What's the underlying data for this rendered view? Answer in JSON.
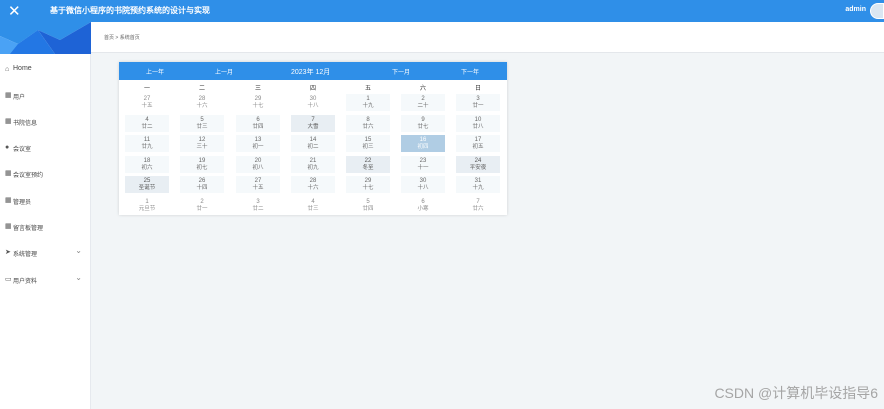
{
  "header": {
    "close_icon": "close-icon",
    "title": "基于微信小程序的书院预约系统的设计与实现",
    "user": "admin"
  },
  "sidebar": {
    "items": [
      {
        "label": "Home",
        "icon": "home-icon",
        "caret": false
      },
      {
        "label": "用户",
        "icon": "grid-icon",
        "caret": false
      },
      {
        "label": "书院信息",
        "icon": "grid-icon",
        "caret": false
      },
      {
        "label": "会议室",
        "icon": "pin-icon",
        "caret": false
      },
      {
        "label": "会议室预约",
        "icon": "grid-icon",
        "caret": false
      },
      {
        "label": "管理员",
        "icon": "grid-icon",
        "caret": false
      },
      {
        "label": "留言板管理",
        "icon": "grid-icon",
        "caret": false
      },
      {
        "label": "系统管理",
        "icon": "send-icon",
        "caret": true
      },
      {
        "label": "用户资料",
        "icon": "card-icon",
        "caret": true
      }
    ]
  },
  "breadcrumb": {
    "home": "首页",
    "separator": ">",
    "current": "系统首页"
  },
  "calendar": {
    "prev_year": "上一年",
    "prev_month": "上一月",
    "title": "2023年 12月",
    "next_month": "下一月",
    "next_year": "下一年",
    "weekdays": [
      "一",
      "二",
      "三",
      "四",
      "五",
      "六",
      "日"
    ],
    "weeks": [
      [
        {
          "d": "27",
          "l": "十五",
          "s": "other"
        },
        {
          "d": "28",
          "l": "十六",
          "s": "other"
        },
        {
          "d": "29",
          "l": "十七",
          "s": "other"
        },
        {
          "d": "30",
          "l": "十八",
          "s": "other"
        },
        {
          "d": "1",
          "l": "十九",
          "s": "cur"
        },
        {
          "d": "2",
          "l": "二十",
          "s": "cur"
        },
        {
          "d": "3",
          "l": "廿一",
          "s": "cur"
        }
      ],
      [
        {
          "d": "4",
          "l": "廿二",
          "s": "cur"
        },
        {
          "d": "5",
          "l": "廿三",
          "s": "cur"
        },
        {
          "d": "6",
          "l": "廿四",
          "s": "cur"
        },
        {
          "d": "7",
          "l": "大雪",
          "s": "fest"
        },
        {
          "d": "8",
          "l": "廿六",
          "s": "cur"
        },
        {
          "d": "9",
          "l": "廿七",
          "s": "cur"
        },
        {
          "d": "10",
          "l": "廿八",
          "s": "cur"
        }
      ],
      [
        {
          "d": "11",
          "l": "廿九",
          "s": "cur"
        },
        {
          "d": "12",
          "l": "三十",
          "s": "cur"
        },
        {
          "d": "13",
          "l": "初一",
          "s": "cur"
        },
        {
          "d": "14",
          "l": "初二",
          "s": "cur"
        },
        {
          "d": "15",
          "l": "初三",
          "s": "cur"
        },
        {
          "d": "16",
          "l": "初四",
          "s": "today"
        },
        {
          "d": "17",
          "l": "初五",
          "s": "cur"
        }
      ],
      [
        {
          "d": "18",
          "l": "初六",
          "s": "cur"
        },
        {
          "d": "19",
          "l": "初七",
          "s": "cur"
        },
        {
          "d": "20",
          "l": "初八",
          "s": "cur"
        },
        {
          "d": "21",
          "l": "初九",
          "s": "cur"
        },
        {
          "d": "22",
          "l": "冬至",
          "s": "fest"
        },
        {
          "d": "23",
          "l": "十一",
          "s": "cur"
        },
        {
          "d": "24",
          "l": "平安夜",
          "s": "fest"
        }
      ],
      [
        {
          "d": "25",
          "l": "圣诞节",
          "s": "fest"
        },
        {
          "d": "26",
          "l": "十四",
          "s": "cur"
        },
        {
          "d": "27",
          "l": "十五",
          "s": "cur"
        },
        {
          "d": "28",
          "l": "十六",
          "s": "cur"
        },
        {
          "d": "29",
          "l": "十七",
          "s": "cur"
        },
        {
          "d": "30",
          "l": "十八",
          "s": "cur"
        },
        {
          "d": "31",
          "l": "十九",
          "s": "cur"
        }
      ],
      [
        {
          "d": "1",
          "l": "元旦节",
          "s": "other"
        },
        {
          "d": "2",
          "l": "廿一",
          "s": "other"
        },
        {
          "d": "3",
          "l": "廿二",
          "s": "other"
        },
        {
          "d": "4",
          "l": "廿三",
          "s": "other"
        },
        {
          "d": "5",
          "l": "廿四",
          "s": "other"
        },
        {
          "d": "6",
          "l": "小寒",
          "s": "other"
        },
        {
          "d": "7",
          "l": "廿六",
          "s": "other"
        }
      ]
    ]
  },
  "watermark": "CSDN @计算机毕设指导6",
  "colors": {
    "primary": "#2f8fe8",
    "today": "#b0cde4"
  }
}
